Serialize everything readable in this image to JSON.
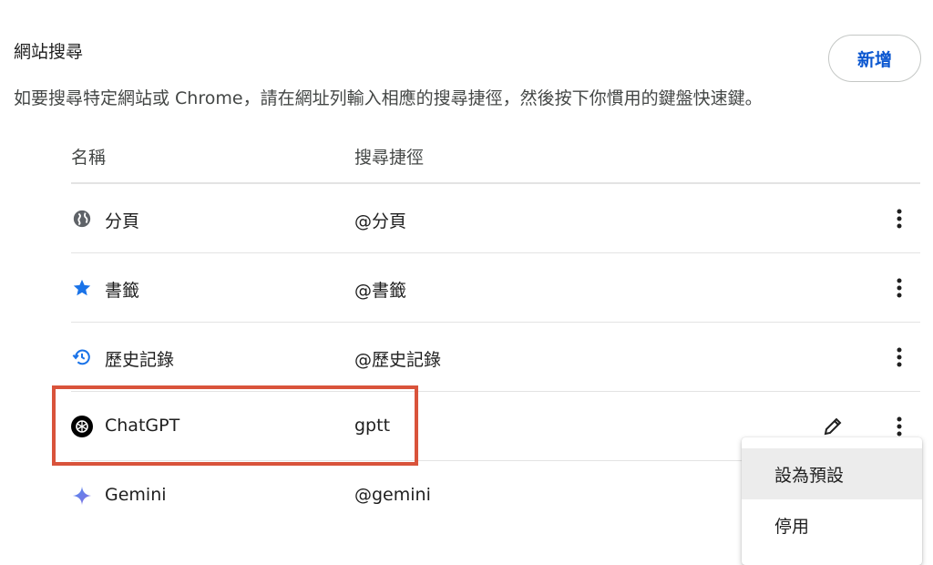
{
  "section": {
    "title": "網站搜尋",
    "description": "如要搜尋特定網站或 Chrome，請在網址列輸入相應的搜尋捷徑，然後按下你慣用的鍵盤快速鍵。",
    "add_label": "新增"
  },
  "columns": {
    "name": "名稱",
    "shortcut": "搜尋捷徑"
  },
  "rows": [
    {
      "name": "分頁",
      "shortcut": "@分頁",
      "icon": "globe-icon"
    },
    {
      "name": "書籤",
      "shortcut": "@書籤",
      "icon": "star-icon"
    },
    {
      "name": "歷史記錄",
      "shortcut": "@歷史記錄",
      "icon": "history-icon"
    },
    {
      "name": "ChatGPT",
      "shortcut": "gptt",
      "icon": "chatgpt-logo-icon"
    },
    {
      "name": "Gemini",
      "shortcut": "@gemini",
      "icon": "gemini-sparkle-icon"
    }
  ],
  "menu": {
    "items": [
      "設為預設",
      "停用"
    ]
  },
  "colors": {
    "accent": "#0b57d0",
    "highlight": "#d9533b",
    "star": "#1a73e8"
  }
}
